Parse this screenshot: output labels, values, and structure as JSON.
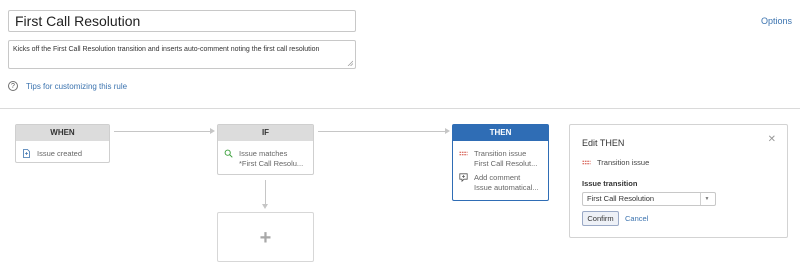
{
  "rule": {
    "name": "First Call Resolution",
    "description": "Kicks off the First Call Resolution transition and inserts auto-comment noting the first call resolution",
    "options_label": "Options",
    "tips_label": "Tips for customizing this rule"
  },
  "flow": {
    "when": {
      "header": "WHEN",
      "item": {
        "icon": "document-icon",
        "label": "Issue created"
      }
    },
    "if": {
      "header": "IF",
      "item": {
        "icon": "search-icon",
        "line1": "Issue matches",
        "line2": "*First Call Resolu..."
      }
    },
    "then": {
      "header": "THEN",
      "items": [
        {
          "icon": "transition-icon",
          "line1": "Transition issue",
          "line2": "First Call Resolut..."
        },
        {
          "icon": "comment-icon",
          "line1": "Add comment",
          "line2": "Issue automatical..."
        }
      ]
    },
    "add_placeholder": {
      "icon": "plus-icon",
      "label": "+"
    }
  },
  "edit_panel": {
    "title": "Edit THEN",
    "close_icon": "close-icon",
    "action_label": "Transition issue",
    "field_label": "Issue transition",
    "selected_value": "First Call Resolution",
    "confirm_label": "Confirm",
    "cancel_label": "Cancel"
  },
  "colors": {
    "accent_blue": "#2f6db5",
    "link_blue": "#3b73af",
    "transition_icon_red": "#d04437",
    "search_icon_green": "#3a9f3a"
  }
}
